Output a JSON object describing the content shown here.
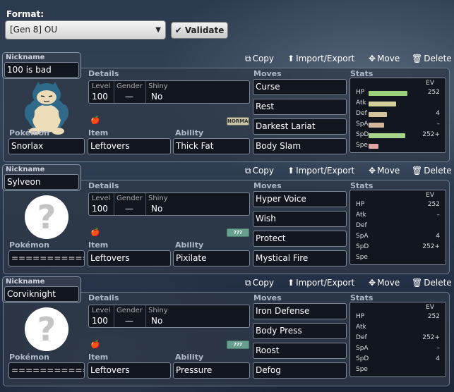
{
  "format": {
    "label": "Format:",
    "selected": "[Gen 8] OU",
    "validate_label": "Validate"
  },
  "actions": {
    "copy": "Copy",
    "import_export": "Import/Export",
    "move": "Move",
    "delete": "Delete"
  },
  "labels": {
    "nickname": "Nickname",
    "details": "Details",
    "moves": "Moves",
    "stats": "Stats",
    "pokemon": "Pokémon",
    "item": "Item",
    "ability": "Ability",
    "level": "Level",
    "gender": "Gender",
    "shiny": "Shiny",
    "ev": "EV"
  },
  "stat_names": [
    "HP",
    "Atk",
    "Def",
    "SpA",
    "SpD",
    "Spe"
  ],
  "sets": [
    {
      "nickname": "100 is bad",
      "pokemon": "Snorlax",
      "item": "Leftovers",
      "ability": "Thick Fat",
      "level": "100",
      "gender": "—",
      "shiny": "No",
      "type_badge": "NORMAL",
      "moves": [
        "Curse",
        "Rest",
        "Darkest Lariat",
        "Body Slam"
      ],
      "evs": [
        "252",
        "",
        "4",
        "–",
        "252+",
        ""
      ],
      "bars": [
        0.78,
        0.56,
        0.37,
        0.31,
        0.74,
        0.2
      ]
    },
    {
      "nickname": "Sylveon",
      "pokemon": "===========",
      "item": "Leftovers",
      "ability": "Pixilate",
      "level": "100",
      "gender": "—",
      "shiny": "No",
      "type_badge": "???",
      "moves": [
        "Hyper Voice",
        "Wish",
        "Protect",
        "Mystical Fire"
      ],
      "evs": [
        "252",
        "–",
        "",
        "4",
        "252+",
        ""
      ],
      "bars": [
        0,
        0,
        0,
        0,
        0,
        0
      ]
    },
    {
      "nickname": "Corviknight",
      "pokemon": "===========",
      "item": "Leftovers",
      "ability": "Pressure",
      "level": "100",
      "gender": "—",
      "shiny": "No",
      "type_badge": "???",
      "moves": [
        "Iron Defense",
        "Body Press",
        "Roost",
        "Defog"
      ],
      "evs": [
        "252",
        "",
        "252+",
        "–",
        "4",
        ""
      ],
      "bars": [
        0,
        0,
        0,
        0,
        0,
        0
      ]
    }
  ],
  "colors": {
    "hp_bar": "#9ad07a",
    "atk_bar": "#d4d09a",
    "def_bar": "#d4c49a",
    "spa_bar": "#d4b49a",
    "spd_bar": "#a6d48a",
    "spe_bar": "#e0a6a0",
    "type_normal": "#c8c4a8",
    "type_unknown": "#68a090"
  }
}
